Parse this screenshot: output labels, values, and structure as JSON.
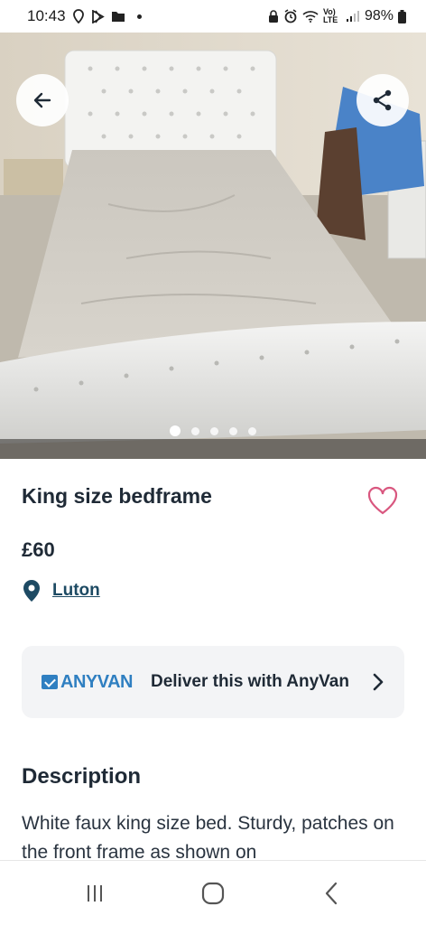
{
  "status_bar": {
    "time": "10:43",
    "battery": "98%",
    "network": "Vo) LTE"
  },
  "gallery": {
    "image_count": 5,
    "active_index": 0,
    "back_icon": "arrow-left-icon",
    "share_icon": "share-icon"
  },
  "listing": {
    "title": "King size bedframe",
    "price": "£60",
    "location": "Luton",
    "favorite_icon": "heart-outline-icon"
  },
  "delivery": {
    "brand": "ANYVAN",
    "label": "Deliver this with AnyVan",
    "icon": "chevron-right-icon"
  },
  "description": {
    "heading": "Description",
    "text": "White faux king size bed. Sturdy, patches on the front frame as shown on"
  },
  "colors": {
    "accent_heart": "#d9577f",
    "link": "#1d4a63",
    "anyvan_blue": "#2f7fc1",
    "text": "#1f2a36"
  }
}
